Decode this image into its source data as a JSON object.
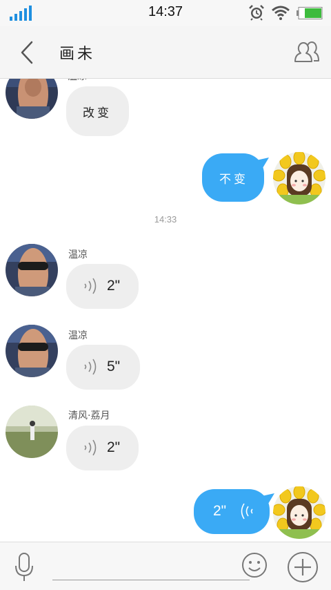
{
  "status_bar": {
    "time": "14:37",
    "icons": [
      "signal-icon",
      "alarm-icon",
      "wifi-icon",
      "battery-icon"
    ]
  },
  "header": {
    "title": "画未",
    "back_icon": "chevron-left-icon",
    "members_icon": "group-members-icon"
  },
  "messages": {
    "m1": {
      "direction": "incoming",
      "sender": "温凉",
      "text": "改变"
    },
    "m2": {
      "direction": "outgoing",
      "text": "不变"
    },
    "timestamp": "14:33",
    "m3": {
      "direction": "incoming",
      "sender": "温凉",
      "type": "voice",
      "duration": "2\""
    },
    "m4": {
      "direction": "incoming",
      "sender": "温凉",
      "type": "voice",
      "duration": "5\""
    },
    "m5": {
      "direction": "incoming",
      "sender": "清风·荔月",
      "type": "voice",
      "duration": "2\""
    },
    "m6": {
      "direction": "outgoing",
      "type": "voice",
      "duration": "2\""
    }
  },
  "input_bar": {
    "voice_icon": "microphone-icon",
    "emoji_icon": "smiley-icon",
    "plus_icon": "plus-icon"
  },
  "colors": {
    "outgoing_bubble": "#3aaaf5",
    "incoming_bubble": "#eeeeee",
    "signal": "#1e8fe0",
    "battery": "#3dbb3d"
  }
}
